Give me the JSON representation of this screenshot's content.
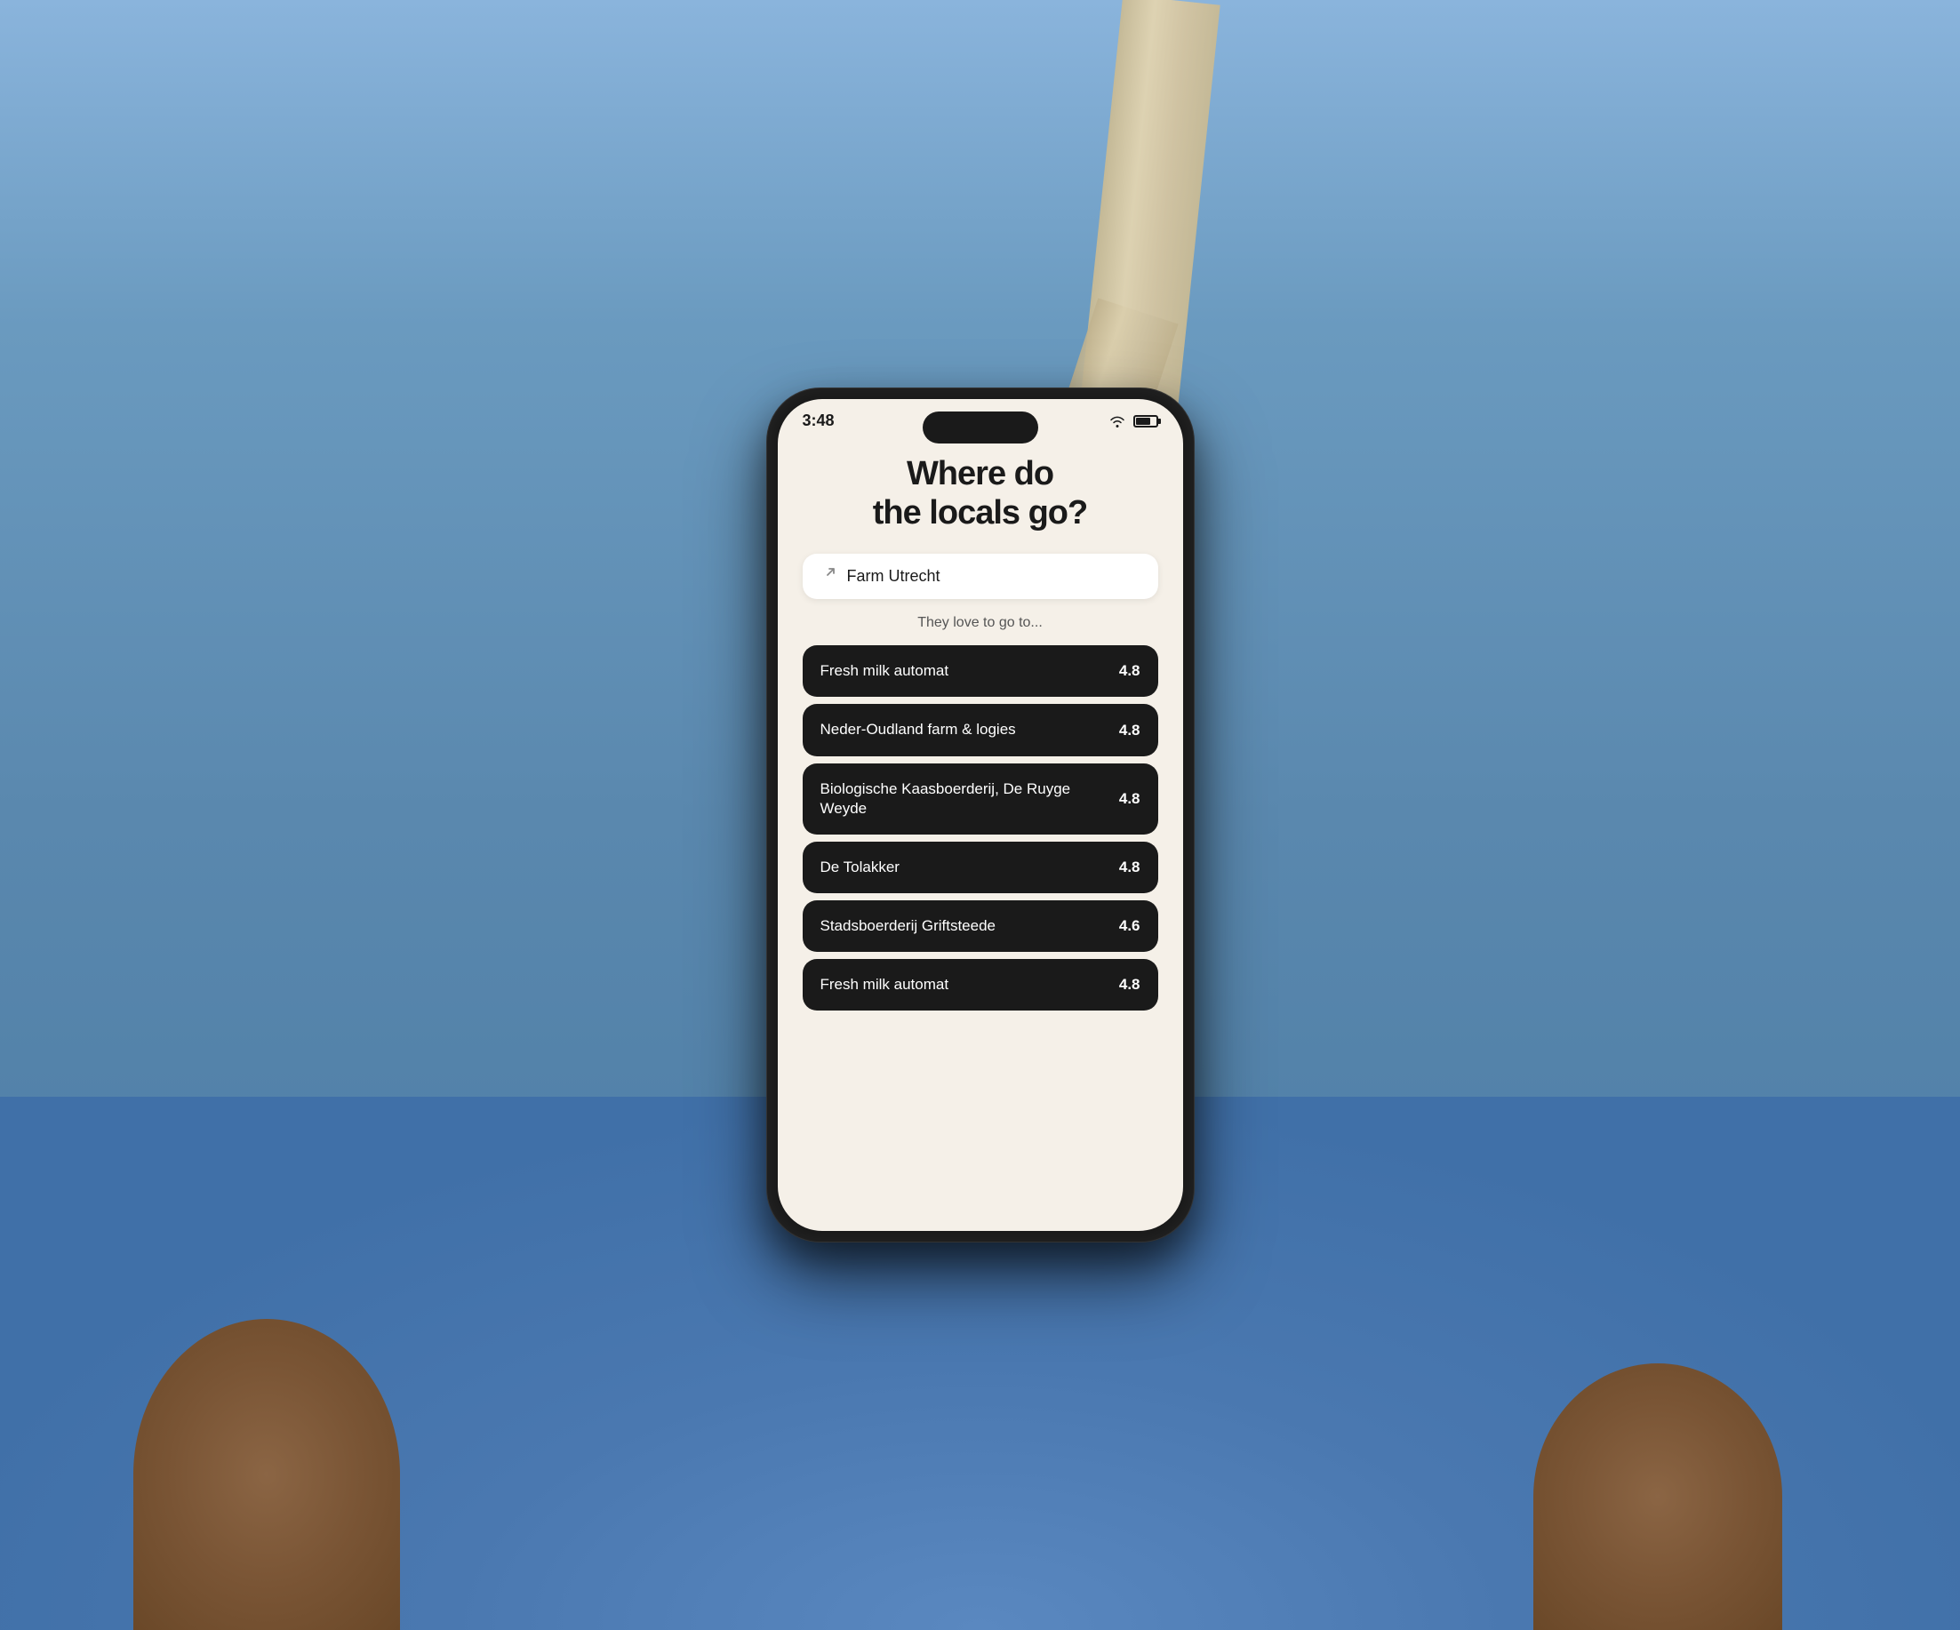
{
  "background": {
    "color": "#7a9cc4"
  },
  "phone": {
    "status_bar": {
      "time": "3:48",
      "wifi_label": "wifi",
      "battery_label": "battery"
    },
    "app": {
      "title_line1": "Where do",
      "title_line2": "the locals go?",
      "search_placeholder": "Farm Utrecht",
      "subtitle": "They love to go to...",
      "items": [
        {
          "name": "Fresh milk automat",
          "rating": "4.8"
        },
        {
          "name": "Neder-Oudland farm & logies",
          "rating": "4.8"
        },
        {
          "name": "Biologische Kaasboerderij, De Ruyge Weyde",
          "rating": "4.8"
        },
        {
          "name": "De Tolakker",
          "rating": "4.8"
        },
        {
          "name": "Stadsboerderij Griftsteede",
          "rating": "4.6"
        },
        {
          "name": "Fresh milk automat",
          "rating": "4.8"
        }
      ]
    }
  }
}
